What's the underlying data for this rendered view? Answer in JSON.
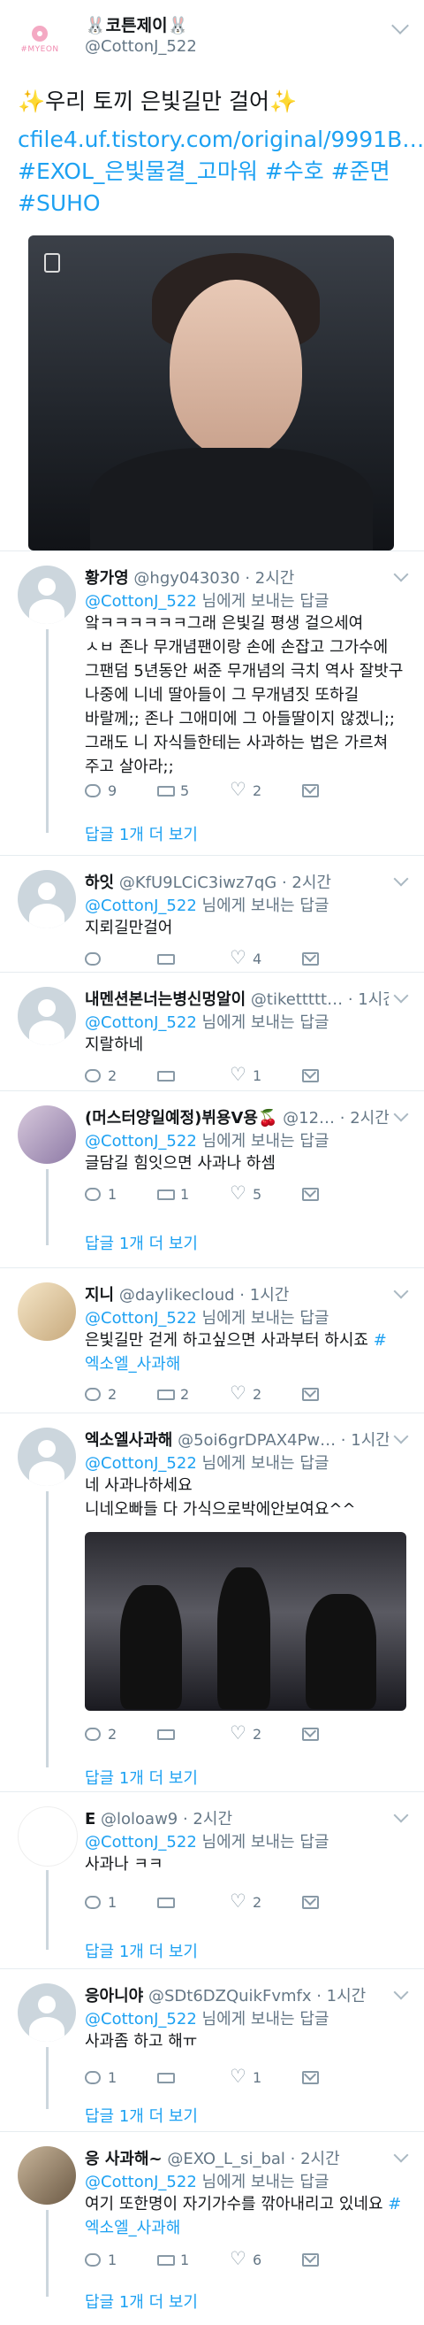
{
  "tweet": {
    "name": "🐰코튼제이🐰",
    "handle": "@CottonJ_522",
    "logo_text": "#MYEON",
    "text": "✨우리 토끼 은빛길만 걸어✨",
    "link": "cfile4.uf.tistory.com/original/9991B…",
    "hashtags_line1": "#EXOL_은빛물결_고마워 #수호 #준면",
    "hashtags_line2": "#SUHO"
  },
  "replying_to_suffix": "님에게 보내는 답글",
  "replies": [
    {
      "name": "황가영",
      "handle": "@hgy043030 · 2시간",
      "to": "@CottonJ_522",
      "lines": [
        "앜ㅋㅋㅋㅋㅋㅋ그래 은빛길 평생 걸으세여",
        "ㅅㅂ 존나 무개념팬이랑 손에 손잡고 그가수에",
        "그팬덤 5년동안 써준 무개념의 극치 역사 잘밧구",
        "나중에 니네 딸아들이 그 무개념짓 또하길",
        "바랄께;; 존나 그애미에 그 아들딸이지 않겠니;;",
        "그래도 니 자식들한테는 사과하는 법은 가르쳐",
        "주고 살아라;;"
      ],
      "reply_count": "9",
      "rt_count": "5",
      "like_count": "2",
      "more": "답글 1개 더 보기"
    },
    {
      "name": "하잇",
      "handle": "@KfU9LCiC3iwz7qG · 2시간",
      "to": "@CottonJ_522",
      "lines": [
        "지뢰길만걸어"
      ],
      "reply_count": "",
      "rt_count": "",
      "like_count": "4"
    },
    {
      "name": "내멘션본너는병신멍알이",
      "handle": "@tikettttt… · 1시간",
      "to": "@CottonJ_522",
      "lines": [
        "지랄하네"
      ],
      "reply_count": "2",
      "rt_count": "",
      "like_count": "1"
    },
    {
      "name": "(머스터양일예정)뷔용V용🍒",
      "handle": "@12… · 2시간",
      "to": "@CottonJ_522",
      "lines": [
        "글담길 힘잇으면 사과나 하셈"
      ],
      "reply_count": "1",
      "rt_count": "1",
      "like_count": "5",
      "more": "답글 1개 더 보기"
    },
    {
      "name": "지니",
      "handle": "@daylikecloud · 1시간",
      "to": "@CottonJ_522",
      "line1": "은빛길만 걷게 하고싶으면 사과부터 하시죠 ",
      "tag1": "#",
      "tag2": "엑소엘_사과해",
      "reply_count": "2",
      "rt_count": "2",
      "like_count": "2"
    },
    {
      "name": "엑소엘사과해",
      "handle": "@5oi6grDPAX4Pw… · 1시간",
      "to": "@CottonJ_522",
      "lines": [
        "네 사과나하세요",
        "니네오빠들 다 가식으로박에안보여요^^"
      ],
      "reply_count": "2",
      "rt_count": "",
      "like_count": "2",
      "more": "답글 1개 더 보기"
    },
    {
      "name": "E",
      "handle": "@loloaw9 · 2시간",
      "to": "@CottonJ_522",
      "lines": [
        "사과나 ㅋㅋ"
      ],
      "reply_count": "1",
      "rt_count": "",
      "like_count": "2",
      "more": "답글 1개 더 보기"
    },
    {
      "name": "응아니야",
      "handle": "@SDt6DZQuikFvmfx · 1시간",
      "to": "@CottonJ_522",
      "lines": [
        "사과좀 하고 해ㅠ"
      ],
      "reply_count": "1",
      "rt_count": "",
      "like_count": "1",
      "more": "답글 1개 더 보기"
    },
    {
      "name": "응 사과해~",
      "handle": "@EXO_L_si_bal · 2시간",
      "to": "@CottonJ_522",
      "line1": "여기 또한명이 자기가수를 깎아내리고 있네요 ",
      "tag1": "#",
      "tag2": "엑소엘_사과해",
      "reply_count": "1",
      "rt_count": "1",
      "like_count": "6",
      "more": "답글 1개 더 보기"
    }
  ]
}
